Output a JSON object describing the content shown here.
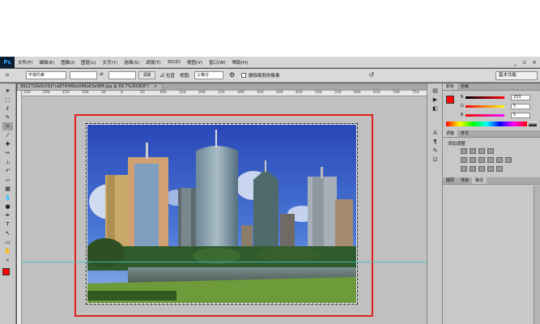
{
  "app": {
    "logo": "Ps"
  },
  "menu": [
    "文件(F)",
    "编辑(E)",
    "图像(I)",
    "图层(L)",
    "文字(Y)",
    "选择(S)",
    "滤镜(T)",
    "3D(D)",
    "视图(V)",
    "窗口(W)",
    "帮助(H)"
  ],
  "window_controls": {
    "minimize": "_",
    "restore": "▫",
    "close": "×"
  },
  "options": {
    "ratio_select": "不受约束",
    "swap_icon": "⇄",
    "clear_label": "清除",
    "straighten_label": "拉直",
    "overlay_label": "视图:",
    "overlay_select": "三等分",
    "gear_icon": "⚙",
    "delete_cropped_label": "删除裁剪的像素",
    "workspace_select": "基本功能"
  },
  "document": {
    "tab_title": "9922720e0cf3d7ca8743f6be096a63a988.jpg @ 66.7%(RGB/8*)",
    "ruler_ticks": [
      "250",
      "200",
      "150",
      "100",
      "50",
      "0",
      "50",
      "100",
      "150",
      "200",
      "250",
      "300",
      "350",
      "400",
      "450",
      "500",
      "550",
      "600",
      "650",
      "700",
      "750"
    ]
  },
  "color_panel": {
    "tabs": [
      "颜色",
      "色板"
    ],
    "sliders": [
      {
        "label": "R",
        "value": "253"
      },
      {
        "label": "G",
        "value": "5"
      },
      {
        "label": "B",
        "value": "5"
      }
    ],
    "foreground_color": "#fd0505"
  },
  "adjust_panel": {
    "tabs": [
      "调整",
      "样式"
    ],
    "title": "添加调整"
  },
  "layers_panel": {
    "tabs": [
      "图层",
      "通道",
      "路径"
    ]
  },
  "colors": {
    "accent_red": "#e0201b",
    "guide": "#3fbfd0",
    "ps_blue": "#31a8ff"
  }
}
